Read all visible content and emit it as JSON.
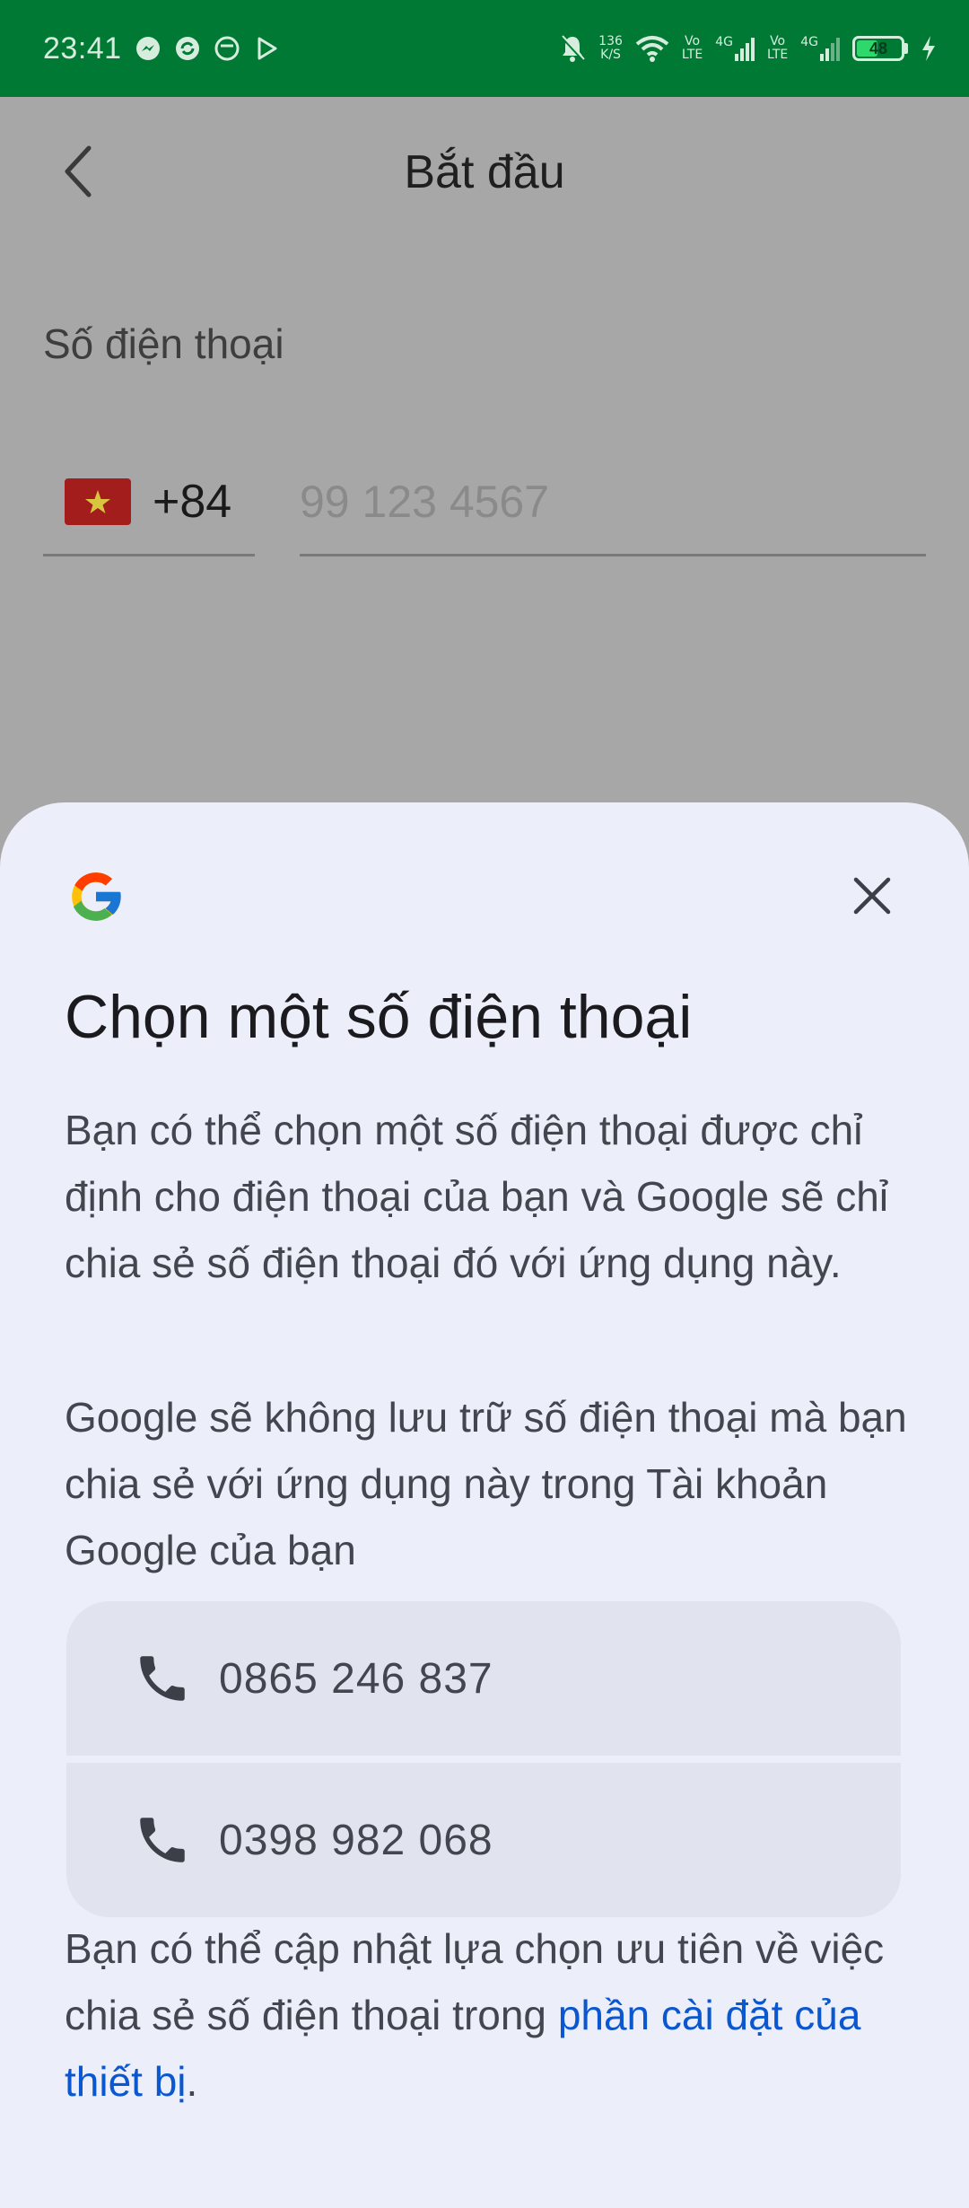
{
  "status_bar": {
    "time": "23:41",
    "net_speed_value": "136",
    "net_speed_unit": "K/S",
    "sim1_volte_top": "Vo",
    "sim1_volte_bottom": "LTE",
    "sim1_network": "4G",
    "sim2_volte_top": "Vo",
    "sim2_volte_bottom": "LTE",
    "sim2_network": "4G",
    "battery_level": "48",
    "battery_fraction": 0.48,
    "notification_icons": [
      "messenger-icon",
      "sync-icon",
      "camera-app-icon",
      "play-store-icon"
    ],
    "colors": {
      "background": "#007934",
      "battery_fill": "#2fd86a"
    }
  },
  "app": {
    "title": "Bắt đầu",
    "phone_label": "Số điện thoại",
    "country_flag": "vietnam-flag-icon",
    "dial_code": "+84",
    "phone_placeholder": "99 123 4567"
  },
  "sheet": {
    "title": "Chọn một số điện thoại",
    "paragraph_1": "Bạn có thể chọn một số điện thoại được chỉ định cho điện thoại của bạn và Google sẽ chỉ chia sẻ số điện thoại đó với ứng dụng này.",
    "paragraph_2": "Google sẽ không lưu trữ số điện thoại mà bạn chia sẻ với ứng dụng này trong Tài khoản Google của bạn",
    "numbers": [
      {
        "number": "0865 246 837",
        "icon": "phone-icon"
      },
      {
        "number": "0398 982 068",
        "icon": "phone-icon"
      }
    ],
    "footer_text": "Bạn có thể cập nhật lựa chọn ưu tiên về việc chia sẻ số điện thoại trong ",
    "footer_link": "phần cài đặt của thiết bị",
    "footer_end": ".",
    "colors": {
      "background": "#eceef9",
      "link": "#0b57d0",
      "list_item": "#e1e3ef"
    }
  }
}
